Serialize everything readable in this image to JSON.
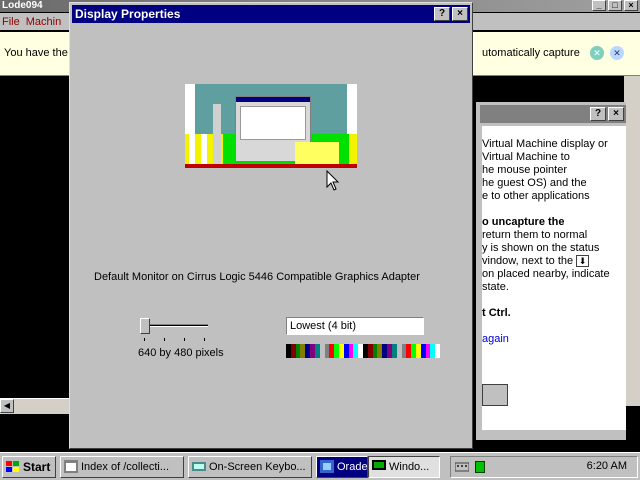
{
  "background_window": {
    "title": "Lode094",
    "menu": [
      "File",
      "Machin"
    ],
    "notice_left": "You have the",
    "notice_right": "utomatically capture"
  },
  "help_window": {
    "paragraphs": [
      "Virtual Machine display or",
      "Virtual Machine to",
      "he mouse pointer",
      "he guest OS) and the",
      "e to other applications"
    ],
    "paragraphs2": [
      "o uncapture the",
      "return them to normal",
      "y is shown on the status",
      "vindow, next to the",
      "on placed nearby, indicate",
      "state."
    ],
    "key_text": "t Ctrl.",
    "link_text": "again"
  },
  "dialog": {
    "title": "Display Properties",
    "monitor_label": "Default Monitor on Cirrus Logic 5446 Compatible Graphics Adapter",
    "resolution_label": "640 by 480 pixels",
    "resolution_fraction": 0.0,
    "color_depth": "Lowest (4 bit)",
    "palette": [
      "#000000",
      "#800000",
      "#008000",
      "#808000",
      "#000080",
      "#800080",
      "#008080",
      "#c0c0c0",
      "#808080",
      "#ff0000",
      "#00ff00",
      "#ffff00",
      "#0000ff",
      "#ff00ff",
      "#00ffff",
      "#ffffff",
      "#000000",
      "#800000",
      "#008000",
      "#808000",
      "#000080",
      "#800080",
      "#008080",
      "#c0c0c0",
      "#808080",
      "#ff0000",
      "#00ff00",
      "#ffff00",
      "#0000ff",
      "#ff00ff",
      "#00ffff",
      "#ffffff"
    ]
  },
  "taskbar": {
    "start_label": "Start",
    "tasks": [
      "Index of /collecti...",
      "On-Screen Keybo...",
      "Orade",
      "Windo..."
    ],
    "clock": "6:20 AM"
  }
}
